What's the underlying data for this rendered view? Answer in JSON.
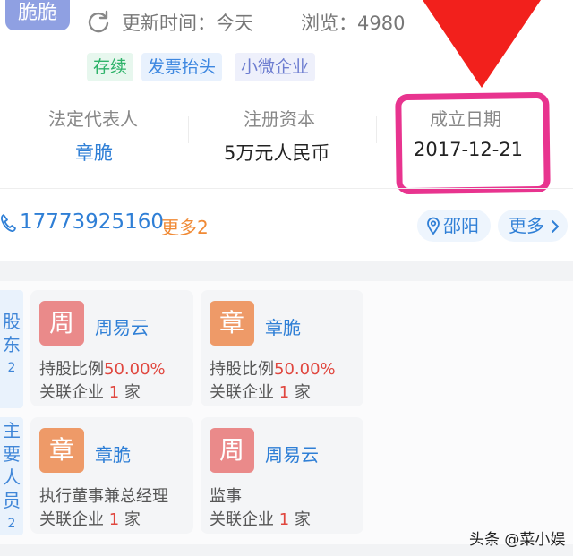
{
  "company": {
    "logo_text": "脆脆",
    "update_label": "更新时间：今天",
    "views_label": "浏览：4980",
    "tags": [
      "存续",
      "发票抬头",
      "小微企业"
    ]
  },
  "stats": [
    {
      "label": "法定代表人",
      "value": "章脆"
    },
    {
      "label": "注册资本",
      "value": "5万元人民币"
    },
    {
      "label": "成立日期",
      "value": "2017-12-21"
    }
  ],
  "contact": {
    "phone": "17773925160",
    "more_phone": "更多2",
    "location": "邵阳",
    "more": "更多"
  },
  "shareholders": {
    "label": "股东",
    "count": "2",
    "cards": [
      {
        "avatar": "周",
        "name": "周易云",
        "line1_prefix": "持股比例",
        "line1_value": "50.00%",
        "line2_prefix": "关联企业",
        "line2_value": "1",
        "line2_suffix": "家"
      },
      {
        "avatar": "章",
        "name": "章脆",
        "line1_prefix": "持股比例",
        "line1_value": "50.00%",
        "line2_prefix": "关联企业",
        "line2_value": "1",
        "line2_suffix": "家"
      }
    ]
  },
  "key_people": {
    "label": "主要人员",
    "count": "2",
    "cards": [
      {
        "avatar": "章",
        "name": "章脆",
        "role": "执行董事兼总经理",
        "line2_prefix": "关联企业",
        "line2_value": "1",
        "line2_suffix": "家"
      },
      {
        "avatar": "周",
        "name": "周易云",
        "role": "监事",
        "line2_prefix": "关联企业",
        "line2_value": "1",
        "line2_suffix": "家"
      }
    ]
  },
  "watermark": "头条 @菜小娱",
  "colors": {
    "accent_blue": "#2f7fd6",
    "highlight_magenta": "#e8348f",
    "arrow_red": "#f2201c",
    "number_red": "#e0473f",
    "orange": "#f08a35"
  },
  "icons": [
    "refresh-icon",
    "phone-icon",
    "location-pin-icon",
    "chevron-right-icon",
    "down-arrow-annotation"
  ]
}
